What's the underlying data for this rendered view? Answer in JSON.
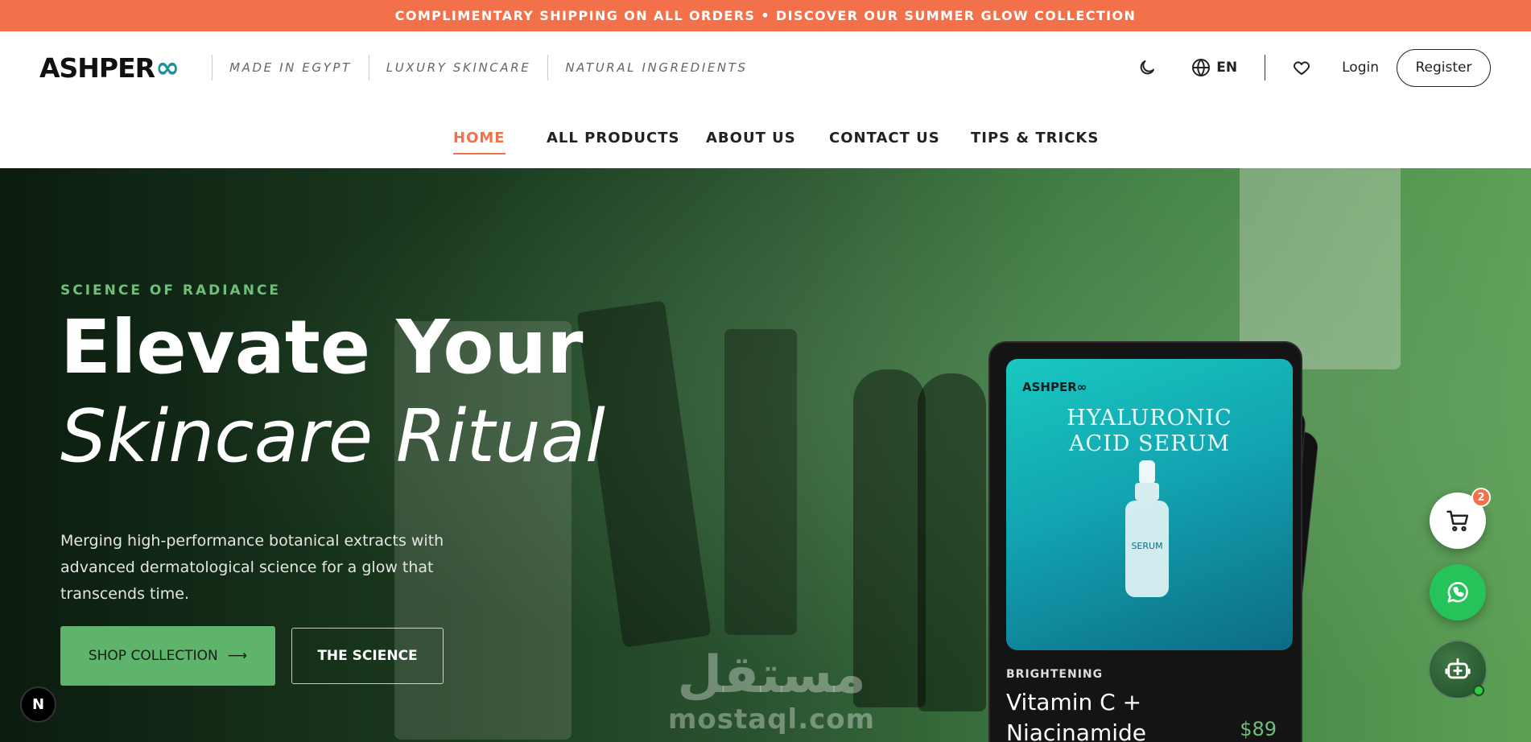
{
  "announcement": "COMPLIMENTARY SHIPPING ON ALL ORDERS • DISCOVER OUR SUMMER GLOW COLLECTION",
  "brand": {
    "logo_text": "ASHPER",
    "logo_symbol": "∞"
  },
  "taglines": [
    "MADE IN EGYPT",
    "LUXURY SKINCARE",
    "NATURAL INGREDIENTS"
  ],
  "header": {
    "language": "EN",
    "login": "Login",
    "register": "Register"
  },
  "nav": [
    {
      "label": "HOME",
      "active": true
    },
    {
      "label": "ALL PRODUCTS"
    },
    {
      "label": "ABOUT US"
    },
    {
      "label": "CONTACT US"
    },
    {
      "label": "TIPS & TRICKS"
    }
  ],
  "hero": {
    "eyebrow": "SCIENCE OF RADIANCE",
    "title_line1": "Elevate Your",
    "title_line2": "Skincare Ritual",
    "lead": "Merging high-performance botanical extracts with advanced dermatological science for a glow that transcends time.",
    "primary_cta": "SHOP COLLECTION",
    "primary_cta_icon": "arrow-right-icon",
    "secondary_cta": "THE SCIENCE"
  },
  "featured_card": {
    "image_logo": "ASHPER∞",
    "image_title_line1": "HYALURONIC",
    "image_title_line2": "ACID SERUM",
    "image_bottle_label": "SERUM",
    "category": "BRIGHTENING",
    "name": "Vitamin C + Niacinamide",
    "price": "$89"
  },
  "cart": {
    "count": "2"
  },
  "dev_badge": "N",
  "watermark": {
    "arabic": "مستقل",
    "latin": "mostaql.com"
  },
  "colors": {
    "accent": "#f2704a",
    "green": "#5db46a",
    "whatsapp": "#25c35a"
  }
}
